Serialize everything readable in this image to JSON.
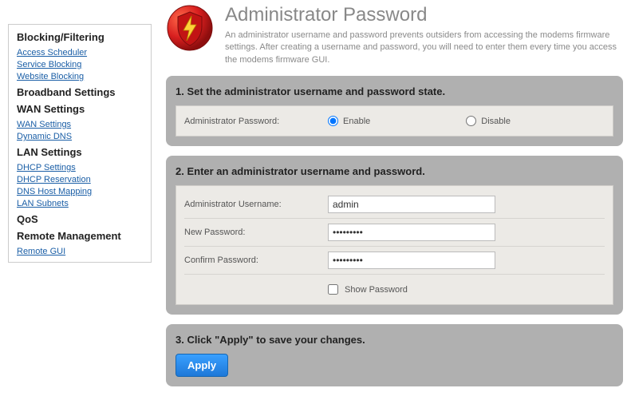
{
  "sidebar": {
    "sections": [
      {
        "heading": "Blocking/Filtering",
        "links": [
          "Access Scheduler",
          "Service Blocking",
          "Website Blocking"
        ]
      },
      {
        "heading": "Broadband Settings",
        "links": []
      },
      {
        "heading": "WAN Settings",
        "links": [
          "WAN Settings",
          "Dynamic DNS"
        ]
      },
      {
        "heading": "LAN Settings",
        "links": [
          "DHCP Settings",
          "DHCP Reservation",
          "DNS Host Mapping",
          "LAN Subnets"
        ]
      },
      {
        "heading": "QoS",
        "links": []
      },
      {
        "heading": "Remote Management",
        "links": [
          "Remote GUI"
        ]
      }
    ]
  },
  "page": {
    "title": "Administrator Password",
    "description": "An administrator username and password prevents outsiders from accessing the modems firmware settings. After creating a username and password, you will need to enter them every time you access the modems firmware GUI."
  },
  "step1": {
    "title": "1. Set the administrator username and password state.",
    "label": "Administrator Password:",
    "enable": "Enable",
    "disable": "Disable",
    "selected": "enable"
  },
  "step2": {
    "title": "2. Enter an administrator username and password.",
    "username_label": "Administrator Username:",
    "username_value": "admin",
    "newpw_label": "New Password:",
    "newpw_value": "•••••••••",
    "confirmpw_label": "Confirm Password:",
    "confirmpw_value": "•••••••••",
    "show_pw_label": "Show Password"
  },
  "step3": {
    "title": "3. Click \"Apply\" to save your changes.",
    "apply": "Apply"
  }
}
